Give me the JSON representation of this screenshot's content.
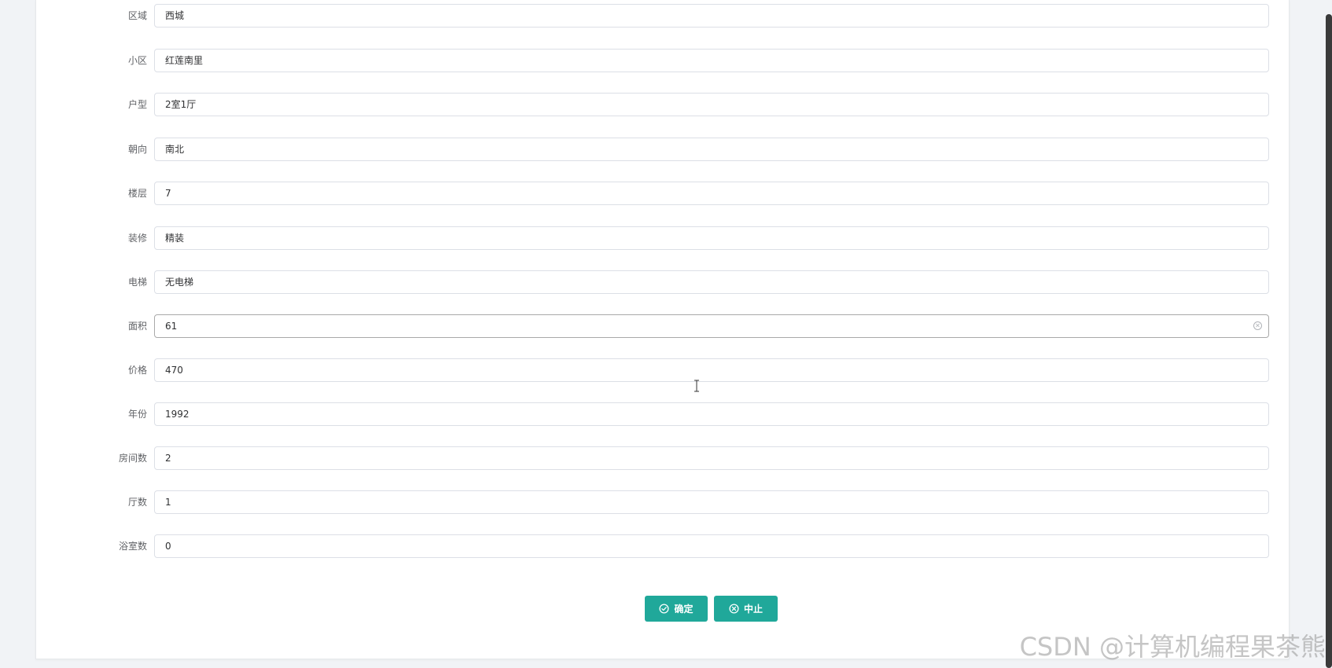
{
  "form": {
    "fields": [
      {
        "label": "区域",
        "value": "西城"
      },
      {
        "label": "小区",
        "value": "红莲南里"
      },
      {
        "label": "户型",
        "value": "2室1厅"
      },
      {
        "label": "朝向",
        "value": "南北"
      },
      {
        "label": "楼层",
        "value": "7"
      },
      {
        "label": "装修",
        "value": "精装"
      },
      {
        "label": "电梯",
        "value": "无电梯"
      },
      {
        "label": "面积",
        "value": "61"
      },
      {
        "label": "价格",
        "value": "470"
      },
      {
        "label": "年份",
        "value": "1992"
      },
      {
        "label": "房间数",
        "value": "2"
      },
      {
        "label": "厅数",
        "value": "1"
      },
      {
        "label": "浴室数",
        "value": "0"
      }
    ]
  },
  "actions": {
    "confirm_label": "确定",
    "abort_label": "中止"
  },
  "watermark": "CSDN @计算机编程果茶熊",
  "colors": {
    "primary": "#20a89a",
    "border": "#dcdfe6",
    "label": "#606266"
  }
}
